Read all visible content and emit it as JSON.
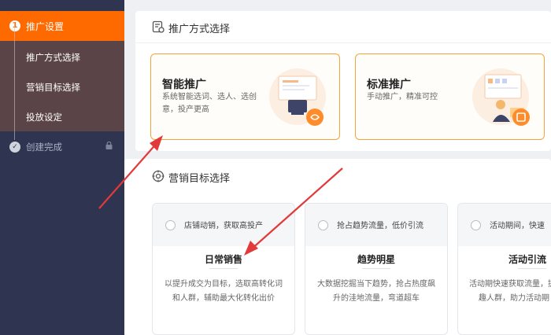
{
  "sidebar": {
    "step1": {
      "number": "1",
      "label": "推广设置"
    },
    "sub_items": [
      "推广方式选择",
      "营销目标选择",
      "投放设定"
    ],
    "step2": {
      "label": "创建完成"
    }
  },
  "promo_section": {
    "title": "推广方式选择",
    "cards": [
      {
        "title": "智能推广",
        "desc_line1": "系统智能选词、选人、选创",
        "desc_line2": "意，投产更高"
      },
      {
        "title": "标准推广",
        "desc_line1": "手动推广，精准可控",
        "desc_line2": ""
      }
    ]
  },
  "goal_section": {
    "title": "营销目标选择",
    "goals": [
      {
        "slogan": "店铺动销，获取高投产",
        "name": "日常销售",
        "desc_line1": "以提升成交为目标，选取高转化词",
        "desc_line2": "和人群，辅助最大化转化出价"
      },
      {
        "slogan": "抢占趋势流量，低价引流",
        "name": "趋势明星",
        "desc_line1": "大数据挖掘当下趋势，抢占热度飙",
        "desc_line2": "升的洼地流量，弯道超车"
      },
      {
        "slogan": "活动期间，快速",
        "name": "活动引流",
        "desc_line1": "活动期快速获取流量，提",
        "desc_line2": "趣人群，助力活动期"
      }
    ]
  },
  "colors": {
    "accent": "#ff6a00",
    "sidebar_bg": "#2f3550",
    "card_border": "#f3a53a",
    "annotation_arrow": "#e23a3a"
  }
}
